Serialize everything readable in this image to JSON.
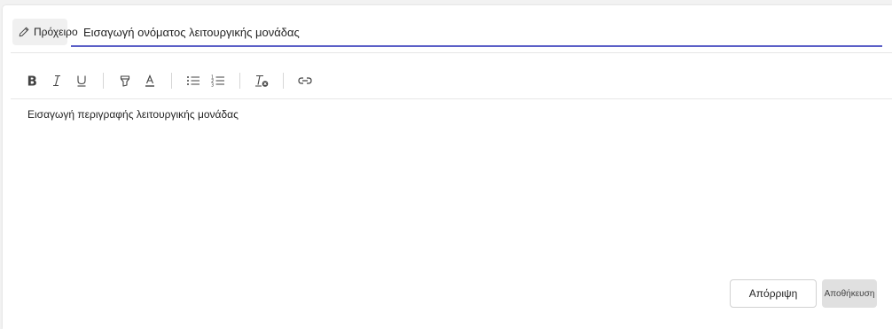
{
  "header": {
    "draft_label": "Πρόχειρο",
    "title_value": "Εισαγωγή ονόματος λειτουργικής μονάδας"
  },
  "toolbar": {
    "items": [
      "bold-icon",
      "italic-icon",
      "underline-icon",
      "highlight-icon",
      "font-color-icon",
      "bulleted-list-icon",
      "numbered-list-icon",
      "clear-formatting-icon",
      "link-icon"
    ]
  },
  "body": {
    "description": "Εισαγωγή περιγραφής λειτουργικής μονάδας"
  },
  "footer": {
    "discard_label": "Απόρριψη",
    "save_label": "Αποθήκευση"
  },
  "colors": {
    "accent": "#5b5fc7",
    "save_bg": "#e0e0e0"
  }
}
